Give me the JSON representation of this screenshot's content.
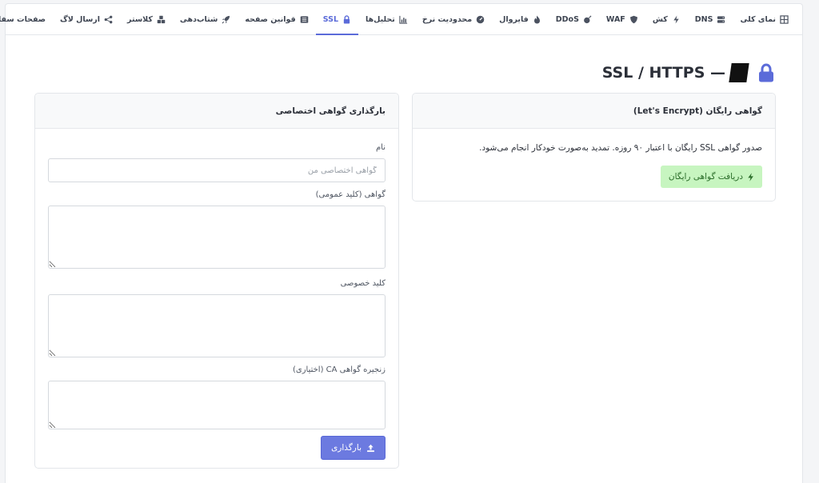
{
  "tabs": [
    {
      "id": "overview",
      "label": "نمای کلی",
      "icon": "grid-icon"
    },
    {
      "id": "dns",
      "label": "DNS",
      "icon": "server-icon"
    },
    {
      "id": "cache",
      "label": "کش",
      "icon": "bolt-icon"
    },
    {
      "id": "waf",
      "label": "WAF",
      "icon": "shield-icon"
    },
    {
      "id": "ddos",
      "label": "DDoS",
      "icon": "bomb-icon"
    },
    {
      "id": "firewall",
      "label": "فایروال",
      "icon": "fire-icon"
    },
    {
      "id": "rate",
      "label": "محدودیت نرخ",
      "icon": "gauge-icon"
    },
    {
      "id": "analytics",
      "label": "تحلیل‌ها",
      "icon": "chart-icon"
    },
    {
      "id": "ssl",
      "label": "SSL",
      "icon": "lock-icon",
      "active": true
    },
    {
      "id": "pagerules",
      "label": "قوانین صفحه",
      "icon": "list-icon"
    },
    {
      "id": "accel",
      "label": "شتاب‌دهی",
      "icon": "rocket-icon"
    },
    {
      "id": "cluster",
      "label": "کلاستر",
      "icon": "cubes-icon"
    },
    {
      "id": "logs",
      "label": "ارسال لاگ",
      "icon": "share-icon"
    },
    {
      "id": "custom",
      "label": "صفحات سفارشی",
      "icon": ""
    }
  ],
  "page": {
    "title": "SSL / HTTPS —",
    "accent": "#5b6bd9"
  },
  "letsencrypt": {
    "header": "گواهی رایگان (Let's Encrypt)",
    "description": "صدور گواهی SSL رایگان با اعتبار ۹۰ روزه. تمدید به‌صورت خودکار انجام می‌شود.",
    "button": "دریافت گواهی رایگان",
    "button_color": "#c7f5c0"
  },
  "upload": {
    "header": "بارگذاری گواهی اختصاصی",
    "name_label": "نام",
    "name_placeholder": "گواهی اختصاصی من",
    "name_value": "",
    "cert_label": "گواهی (کلید عمومی)",
    "cert_value": "",
    "key_label": "کلید خصوصی",
    "key_value": "",
    "chain_label": "زنجیره گواهی CA (اختیاری)",
    "chain_value": "",
    "button": "بارگذاری",
    "button_color": "#6c7ae0"
  }
}
